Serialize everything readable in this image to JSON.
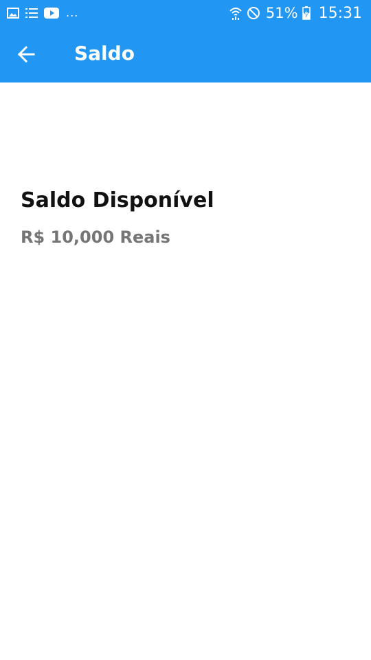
{
  "status_bar": {
    "battery_percent": "51%",
    "time": "15:31",
    "overflow_indicator": "...",
    "left_icons": [
      "image-icon",
      "list-icon",
      "youtube-icon"
    ],
    "right_icons": [
      "wifi-icon",
      "do-not-disturb-icon",
      "battery-charging-icon"
    ]
  },
  "app_bar": {
    "title": "Saldo",
    "back_icon": "arrow-back-icon"
  },
  "balance": {
    "heading": "Saldo Disponível",
    "value": "R$ 10,000 Reais"
  },
  "colors": {
    "primary": "#2196f3",
    "heading_text": "#111111",
    "value_text": "#757575",
    "background": "#ffffff"
  }
}
